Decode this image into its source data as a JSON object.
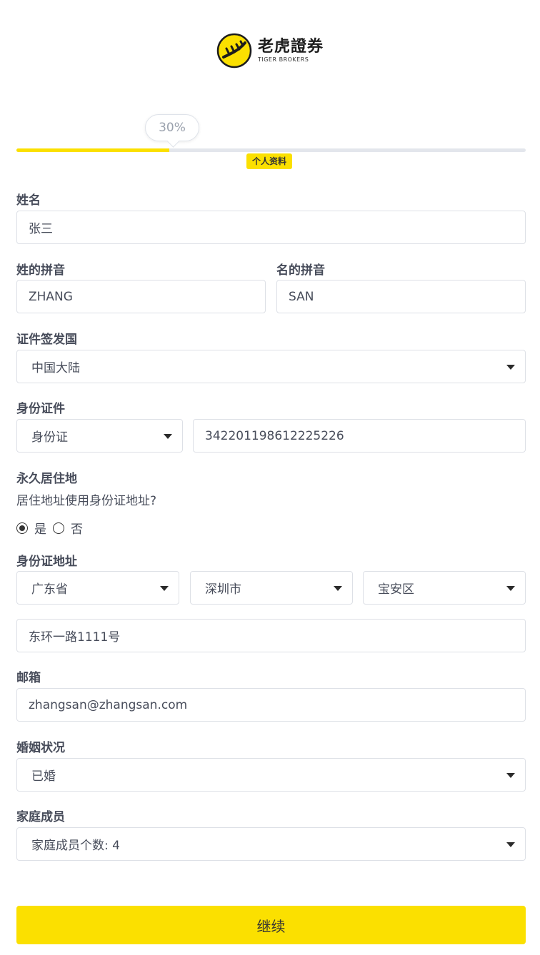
{
  "brand": {
    "name_cn": "老虎證券",
    "name_en": "TIGER BROKERS"
  },
  "progress": {
    "percent_label": "30%",
    "value": 0.3,
    "step_label": "个人资料"
  },
  "form": {
    "name": {
      "label": "姓名",
      "value": "张三"
    },
    "surname_pinyin": {
      "label": "姓的拼音",
      "value": "ZHANG"
    },
    "given_pinyin": {
      "label": "名的拼音",
      "value": "SAN"
    },
    "issuing_country": {
      "label": "证件签发国",
      "value": "中国大陆"
    },
    "id_doc": {
      "label": "身份证件",
      "type": "身份证",
      "number": "342201198612225226"
    },
    "residence": {
      "label": "永久居住地",
      "question": "居住地址使用身份证地址?",
      "options": [
        "是",
        "否"
      ],
      "selected": "是"
    },
    "id_address": {
      "label": "身份证地址",
      "province": "广东省",
      "city": "深圳市",
      "district": "宝安区",
      "street": "东环一路1111号"
    },
    "email": {
      "label": "邮箱",
      "value": "zhangsan@zhangsan.com"
    },
    "marital": {
      "label": "婚姻状况",
      "value": "已婚"
    },
    "family": {
      "label": "家庭成员",
      "value": "家庭成员个数: 4"
    }
  },
  "continue_label": "继续",
  "colors": {
    "accent": "#fbe000",
    "text": "#474c5a",
    "border": "#dde0e6"
  }
}
